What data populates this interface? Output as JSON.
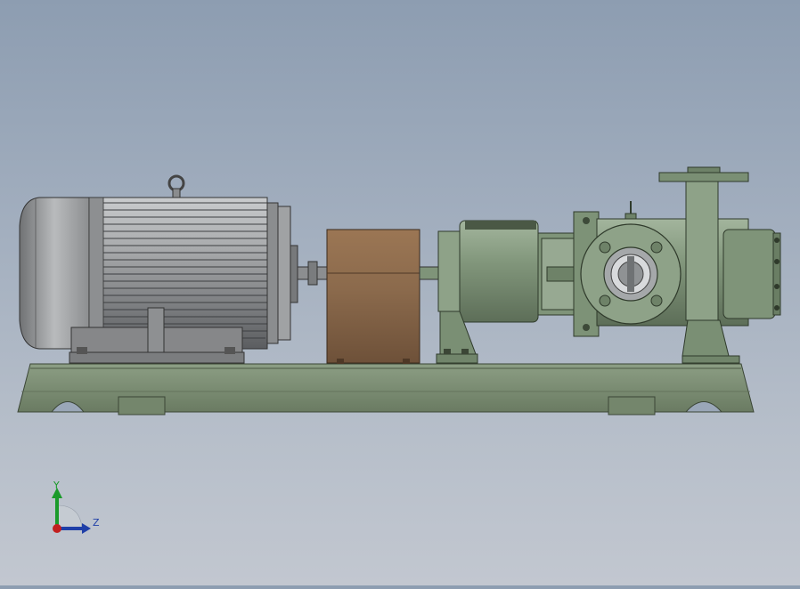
{
  "view": {
    "background_top": "#8d9db1",
    "background_bottom": "#c2c7d0"
  },
  "model": {
    "motor_color": "#9a9c9e",
    "pump_color": "#7f9479",
    "coupling_guard_color": "#8b6a4c",
    "baseplate_color": "#7b8d72"
  },
  "triad": {
    "y_label": "Y",
    "z_label": "Z",
    "y_color": "#1a9a2a",
    "z_color": "#1f3fa8",
    "x_color": "#c21f1f",
    "icons": [
      "reference-triad-icon"
    ]
  }
}
